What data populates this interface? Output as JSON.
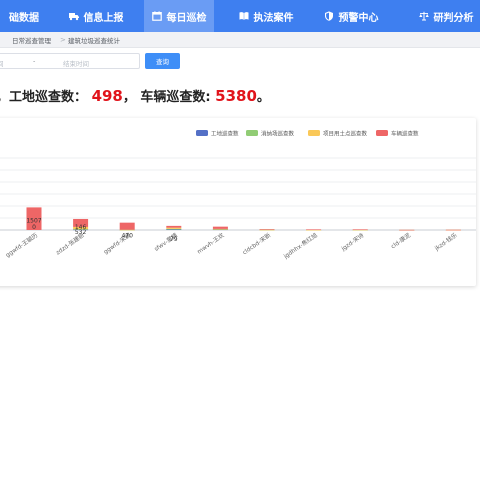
{
  "nav": {
    "items": [
      {
        "label": "础数据",
        "icon": "database-icon",
        "active": false
      },
      {
        "label": "信息上报",
        "icon": "truck-icon",
        "active": false
      },
      {
        "label": "每日巡检",
        "icon": "calendar-icon",
        "active": true
      },
      {
        "label": "执法案件",
        "icon": "book-icon",
        "active": false
      },
      {
        "label": "预警中心",
        "icon": "shield-icon",
        "active": false
      },
      {
        "label": "研判分析",
        "icon": "scale-icon",
        "active": false
      }
    ]
  },
  "breadcrumb": {
    "items": [
      "日常巡查管理",
      "建筑垃圾巡查统计"
    ],
    "separator": ">"
  },
  "filters": {
    "start_placeholder": "间",
    "separator": "-",
    "end_placeholder": "结束时间",
    "query_label": "查询"
  },
  "stats": {
    "prefix": "，",
    "site_label": "工地巡查数：",
    "site_value": "498",
    "middle": "，",
    "vehicle_label": "车辆巡查数: ",
    "vehicle_value": "5380",
    "suffix": "。"
  },
  "chart_data": {
    "type": "bar",
    "stacked": true,
    "legend_position": "top-right",
    "grid": true,
    "categories": [
      "ggwfd-王毓历",
      "zdzd-张建新",
      "ggwfd-宋颖",
      "sfwv-童姨",
      "mwvh-王欢",
      "cldcbd-宋新",
      "jgdhhx-焦红旭",
      "jgzd-宋诗",
      "cld-康泥",
      "jkzd-钱乐",
      "jxcg-江鹏"
    ],
    "series": [
      {
        "name": "工地巡查数",
        "color": "#5470c6",
        "values": [
          0,
          28,
          8,
          55,
          38,
          12,
          5,
          10,
          4,
          7,
          6
        ]
      },
      {
        "name": "消纳场巡查数",
        "color": "#91cc75",
        "values": [
          0,
          30,
          5,
          20,
          15,
          3,
          2,
          3,
          1,
          2,
          1
        ]
      },
      {
        "name": "项目用土点巡查数",
        "color": "#fac858",
        "values": [
          0,
          146,
          6,
          79,
          20,
          3,
          2,
          4,
          1,
          2,
          1
        ]
      },
      {
        "name": "车辆巡查数",
        "color": "#ee6666",
        "values": [
          1507,
          532,
          470,
          120,
          150,
          40,
          35,
          28,
          8,
          6,
          5
        ]
      }
    ],
    "data_labels": [
      {
        "category": "ggwfd-王毓历",
        "values": [
          "1507",
          "0"
        ]
      },
      {
        "category": "zdzd-张建新",
        "values": [
          "532",
          "146"
        ]
      },
      {
        "category": "ggwfd-宋颖",
        "values": [
          "470"
        ]
      },
      {
        "category": "sfwv-童姨",
        "values": [
          "79"
        ]
      }
    ],
    "ylim": [
      0,
      4800
    ]
  }
}
